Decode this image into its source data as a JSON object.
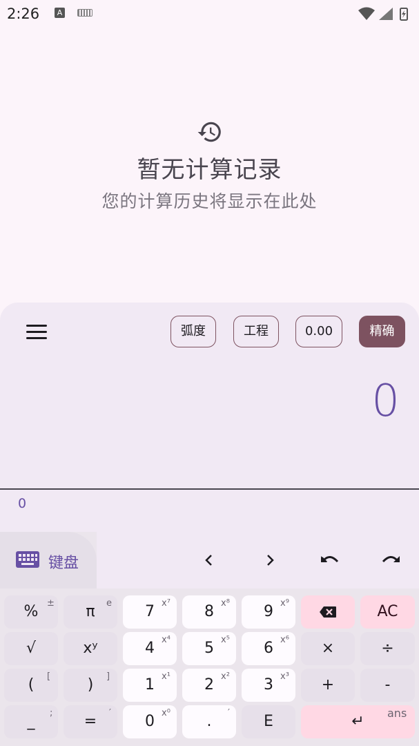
{
  "status_bar": {
    "time": "2:26",
    "a_badge": "A"
  },
  "history": {
    "title": "暂无计算记录",
    "subtitle": "您的计算历史将显示在此处"
  },
  "toolbar": {
    "chips": [
      "弧度",
      "工程",
      "0.00",
      "精确"
    ]
  },
  "display": {
    "value": "0",
    "preview": "0"
  },
  "keyboard_tab": {
    "label": "键盘"
  },
  "keys": [
    {
      "main": "%",
      "sup": "±"
    },
    {
      "main": "π",
      "sup": "e"
    },
    {
      "main": "7",
      "sup": "x⁷"
    },
    {
      "main": "8",
      "sup": "x⁸"
    },
    {
      "main": "9",
      "sup": "x⁹"
    },
    {
      "main": "⌫",
      "sup": ""
    },
    {
      "main": "AC",
      "sup": ""
    },
    {
      "main": "√",
      "sup": ""
    },
    {
      "main": "xʸ",
      "sup": ""
    },
    {
      "main": "4",
      "sup": "x⁴"
    },
    {
      "main": "5",
      "sup": "x⁵"
    },
    {
      "main": "6",
      "sup": "x⁶"
    },
    {
      "main": "×",
      "sup": ""
    },
    {
      "main": "÷",
      "sup": ""
    },
    {
      "main": "(",
      "sup": "["
    },
    {
      "main": ")",
      "sup": "]"
    },
    {
      "main": "1",
      "sup": "x¹"
    },
    {
      "main": "2",
      "sup": "x²"
    },
    {
      "main": "3",
      "sup": "x³"
    },
    {
      "main": "+",
      "sup": ""
    },
    {
      "main": "-",
      "sup": ""
    },
    {
      "main": "_",
      "sup": ";"
    },
    {
      "main": "=",
      "sup": "′"
    },
    {
      "main": "0",
      "sup": "x⁰"
    },
    {
      "main": ".",
      "sup": "′"
    },
    {
      "main": "E",
      "sup": ""
    },
    {
      "main": "↵",
      "sup": "ans"
    }
  ],
  "colors": {
    "accent": "#6750a4",
    "chip_filled": "#7d5260",
    "ac_bg": "#ffd8e4"
  }
}
